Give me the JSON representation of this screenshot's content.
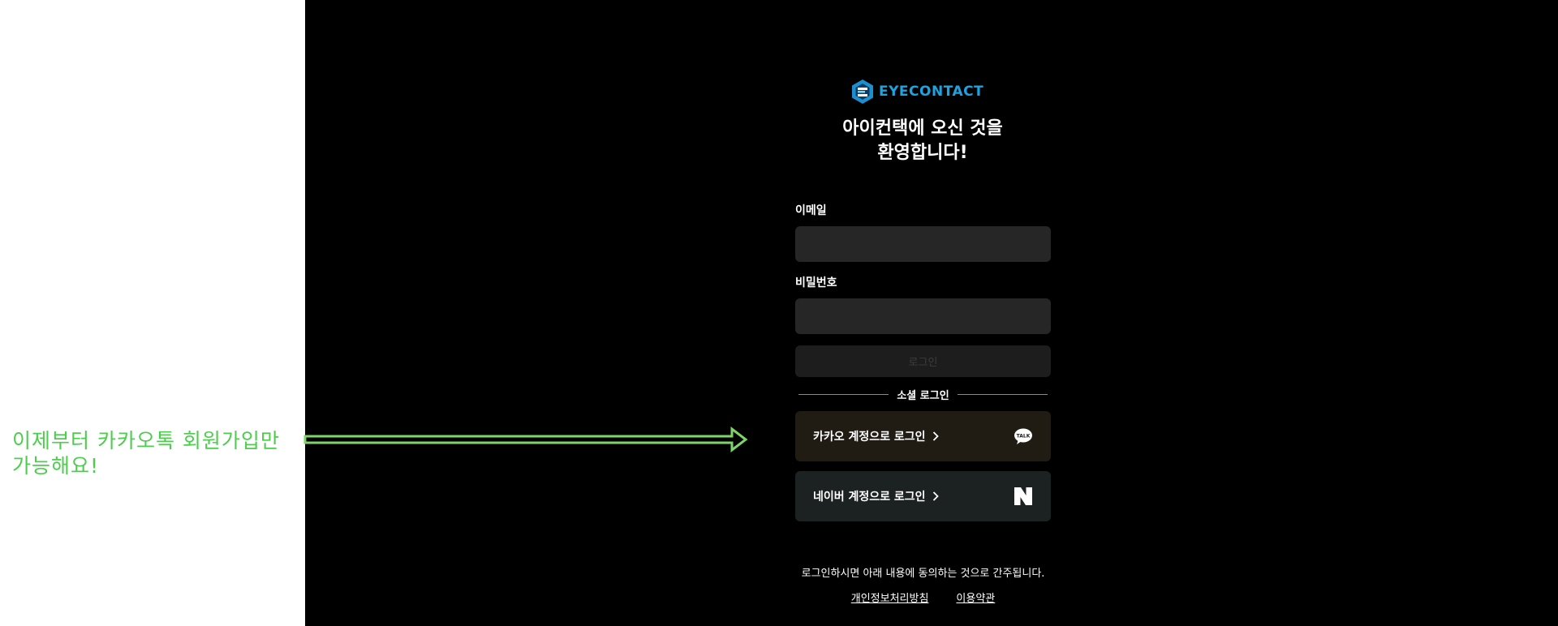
{
  "annotation": {
    "text": "이제부터 카카오톡 회원가입만\n가능해요!",
    "color": "#4ccd4c"
  },
  "brand": {
    "name": "EYECONTACT",
    "logo_icon": "eyecontact-hexagon-logo-icon",
    "color": "#1fa3e0"
  },
  "welcome": {
    "title": "아이컨택에 오신 것을\n환영합니다!"
  },
  "form": {
    "email_label": "이메일",
    "email_value": "",
    "password_label": "비밀번호",
    "password_value": "",
    "login_button": "로그인"
  },
  "social": {
    "divider_label": "소셜 로그인",
    "kakao_label": "카카오 계정으로 로그인",
    "kakao_icon": "kakao-talk-icon",
    "naver_label": "네이버 계정으로 로그인",
    "naver_icon": "naver-n-icon"
  },
  "footer": {
    "notice": "로그인하시면 아래 내용에 동의하는 것으로 간주됩니다.",
    "privacy_link": "개인정보처리방침",
    "terms_link": "이용약관"
  }
}
